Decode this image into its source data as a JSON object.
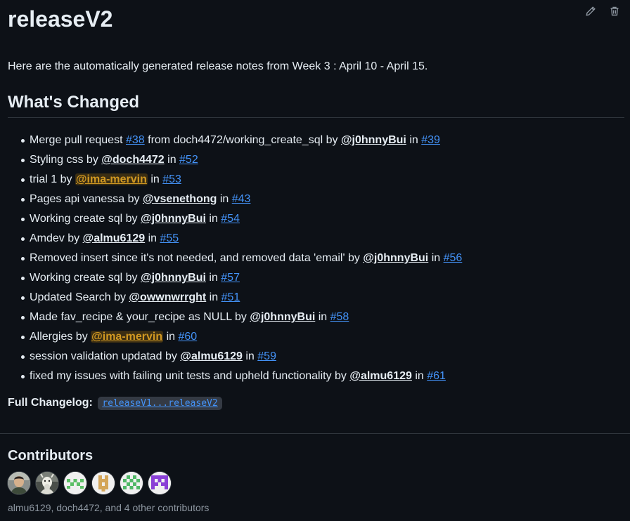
{
  "release": {
    "title": "releaseV2",
    "intro": "Here are the automatically generated release notes from Week 3 : April 10 - April 15."
  },
  "actions": {
    "edit_icon": "pencil-icon",
    "delete_icon": "trash-icon"
  },
  "whats_changed": {
    "heading": "What's Changed",
    "items": [
      {
        "prefix": "Merge pull request ",
        "pr_ref": "#38",
        "mid": " from doch4472/working_create_sql by ",
        "user": "@j0hnnyBui",
        "in_word": " in ",
        "pr": "#39"
      },
      {
        "prefix": "Styling css by ",
        "user": "@doch4472",
        "in_word": " in ",
        "pr": "#52"
      },
      {
        "prefix": "trial 1 by ",
        "user": "@ima-mervin",
        "in_word": " in ",
        "pr": "#53"
      },
      {
        "prefix": "Pages api vanessa by ",
        "user": "@vsenethong",
        "in_word": " in ",
        "pr": "#43"
      },
      {
        "prefix": "Working create sql by ",
        "user": "@j0hnnyBui",
        "in_word": " in ",
        "pr": "#54"
      },
      {
        "prefix": "Amdev by ",
        "user": "@almu6129",
        "in_word": " in ",
        "pr": "#55"
      },
      {
        "prefix": "Removed insert since it's not needed, and removed data 'email' by ",
        "user": "@j0hnnyBui",
        "in_word": " in ",
        "pr": "#56"
      },
      {
        "prefix": "Working create sql by ",
        "user": "@j0hnnyBui",
        "in_word": " in ",
        "pr": "#57"
      },
      {
        "prefix": "Updated Search by ",
        "user": "@owwnwrrght",
        "in_word": " in ",
        "pr": "#51"
      },
      {
        "prefix": "Made fav_recipe & your_recipe as NULL by ",
        "user": "@j0hnnyBui",
        "in_word": " in ",
        "pr": "#58"
      },
      {
        "prefix": "Allergies by ",
        "user": "@ima-mervin",
        "in_word": " in ",
        "pr": "#60"
      },
      {
        "prefix": "session validation updatad by ",
        "user": "@almu6129",
        "in_word": " in ",
        "pr": "#59"
      },
      {
        "prefix": "fixed my issues with failing unit tests and upheld functionality by ",
        "user": "@almu6129",
        "in_word": " in ",
        "pr": "#61"
      }
    ]
  },
  "changelog": {
    "label": "Full Changelog:",
    "link": "releaseV1...releaseV2"
  },
  "contributors": {
    "heading": "Contributors",
    "avatars": [
      "avatar-photo-icon",
      "avatar-goat-icon",
      "identicon-green-icon",
      "identicon-tan-icon",
      "identicon-green2-icon",
      "identicon-purple-icon"
    ],
    "summary": "almu6129, doch4472, and 4 other contributors"
  },
  "colors": {
    "background": "#0d1117",
    "link": "#4493f8",
    "highlight": "#d29922",
    "muted": "#8d96a0"
  }
}
